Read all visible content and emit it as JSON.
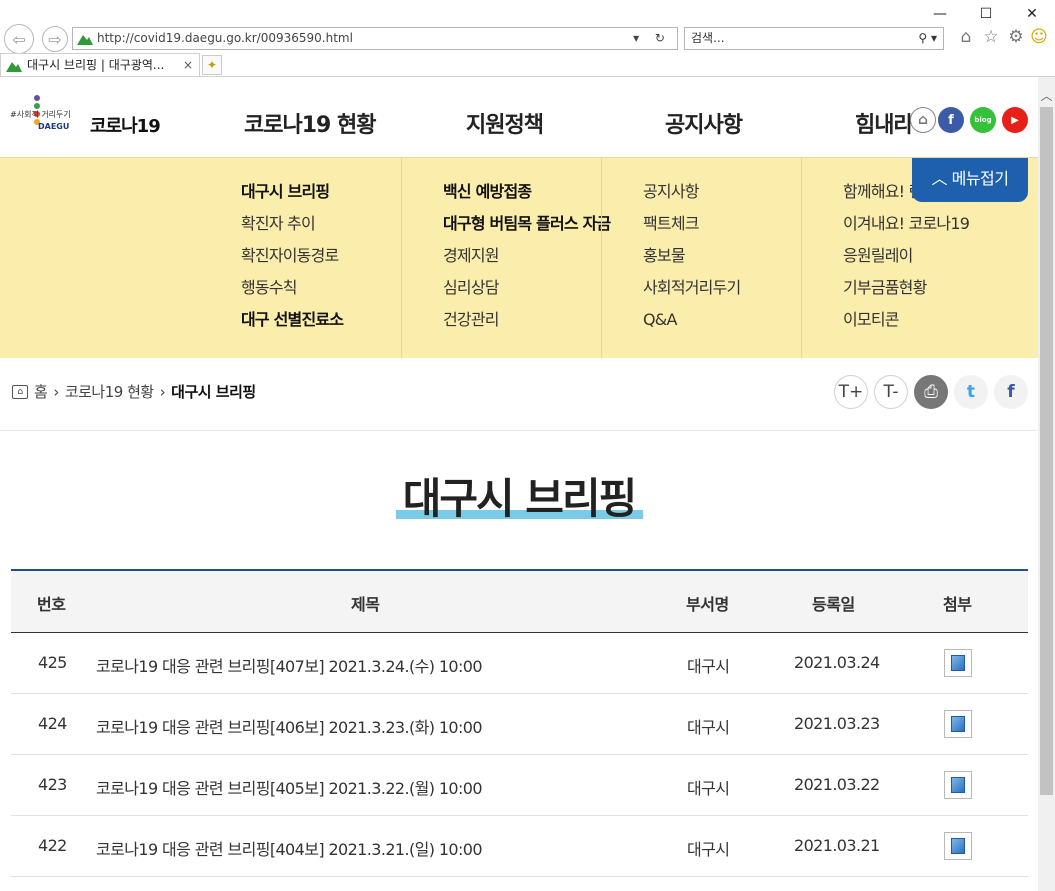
{
  "browser": {
    "url": "http://covid19.daegu.go.kr/00936590.html",
    "search_placeholder": "검색...",
    "tab_title": "대구시 브리핑 | 대구광역...",
    "tab_close": "×"
  },
  "header": {
    "logo_small": "#사회적 거리두기",
    "logo_daegu": "DAEGU",
    "brand": "코로나19",
    "gnb": [
      "코로나19 현황",
      "지원정책",
      "공지사항",
      "힘내라"
    ]
  },
  "mega_menu": {
    "columns": [
      {
        "items": [
          {
            "label": "대구시 브리핑",
            "bold": true
          },
          {
            "label": "확진자 추이",
            "bold": false
          },
          {
            "label": "확진자이동경로",
            "bold": false
          },
          {
            "label": "행동수칙",
            "bold": false
          },
          {
            "label": "대구 선별진료소",
            "bold": true
          }
        ]
      },
      {
        "items": [
          {
            "label": "백신 예방접종",
            "bold": true
          },
          {
            "label": "대구형 버팀목 플러스 자금",
            "bold": true
          },
          {
            "label": "경제지원",
            "bold": false
          },
          {
            "label": "심리상담",
            "bold": false
          },
          {
            "label": "건강관리",
            "bold": false
          }
        ]
      },
      {
        "items": [
          {
            "label": "공지사항",
            "bold": false
          },
          {
            "label": "팩트체크",
            "bold": false
          },
          {
            "label": "홍보물",
            "bold": false
          },
          {
            "label": "사회적거리두기",
            "bold": false
          },
          {
            "label": "Q&A",
            "bold": false
          }
        ]
      },
      {
        "items": [
          {
            "label": "함께해요! 랜",
            "bold": false
          },
          {
            "label": "이겨내요! 코로나19",
            "bold": false
          },
          {
            "label": "응원릴레이",
            "bold": false
          },
          {
            "label": "기부금품현황",
            "bold": false
          },
          {
            "label": "이모티콘",
            "bold": false
          }
        ]
      }
    ],
    "fold_label": "메뉴접기"
  },
  "breadcrumb": {
    "home": "홈",
    "level1": "코로나19 현황",
    "current": "대구시 브리핑"
  },
  "utility": {
    "font_up": "T+",
    "font_down": "T-"
  },
  "page_title": "대구시 브리핑",
  "board": {
    "headers": [
      "번호",
      "제목",
      "부서명",
      "등록일",
      "첨부"
    ],
    "rows": [
      {
        "no": "425",
        "title": "코로나19 대응 관련 브리핑[407보] 2021.3.24.(수) 10:00",
        "dept": "대구시",
        "date": "2021.03.24"
      },
      {
        "no": "424",
        "title": "코로나19 대응 관련 브리핑[406보] 2021.3.23.(화) 10:00",
        "dept": "대구시",
        "date": "2021.03.23"
      },
      {
        "no": "423",
        "title": "코로나19 대응 관련 브리핑[405보] 2021.3.22.(월) 10:00",
        "dept": "대구시",
        "date": "2021.03.22"
      },
      {
        "no": "422",
        "title": "코로나19 대응 관련 브리핑[404보] 2021.3.21.(일) 10:00",
        "dept": "대구시",
        "date": "2021.03.21"
      }
    ]
  },
  "colors": {
    "mega_bg": "#fbeead",
    "accent_blue": "#1e5fae",
    "title_highlight": "#79cbe8"
  }
}
